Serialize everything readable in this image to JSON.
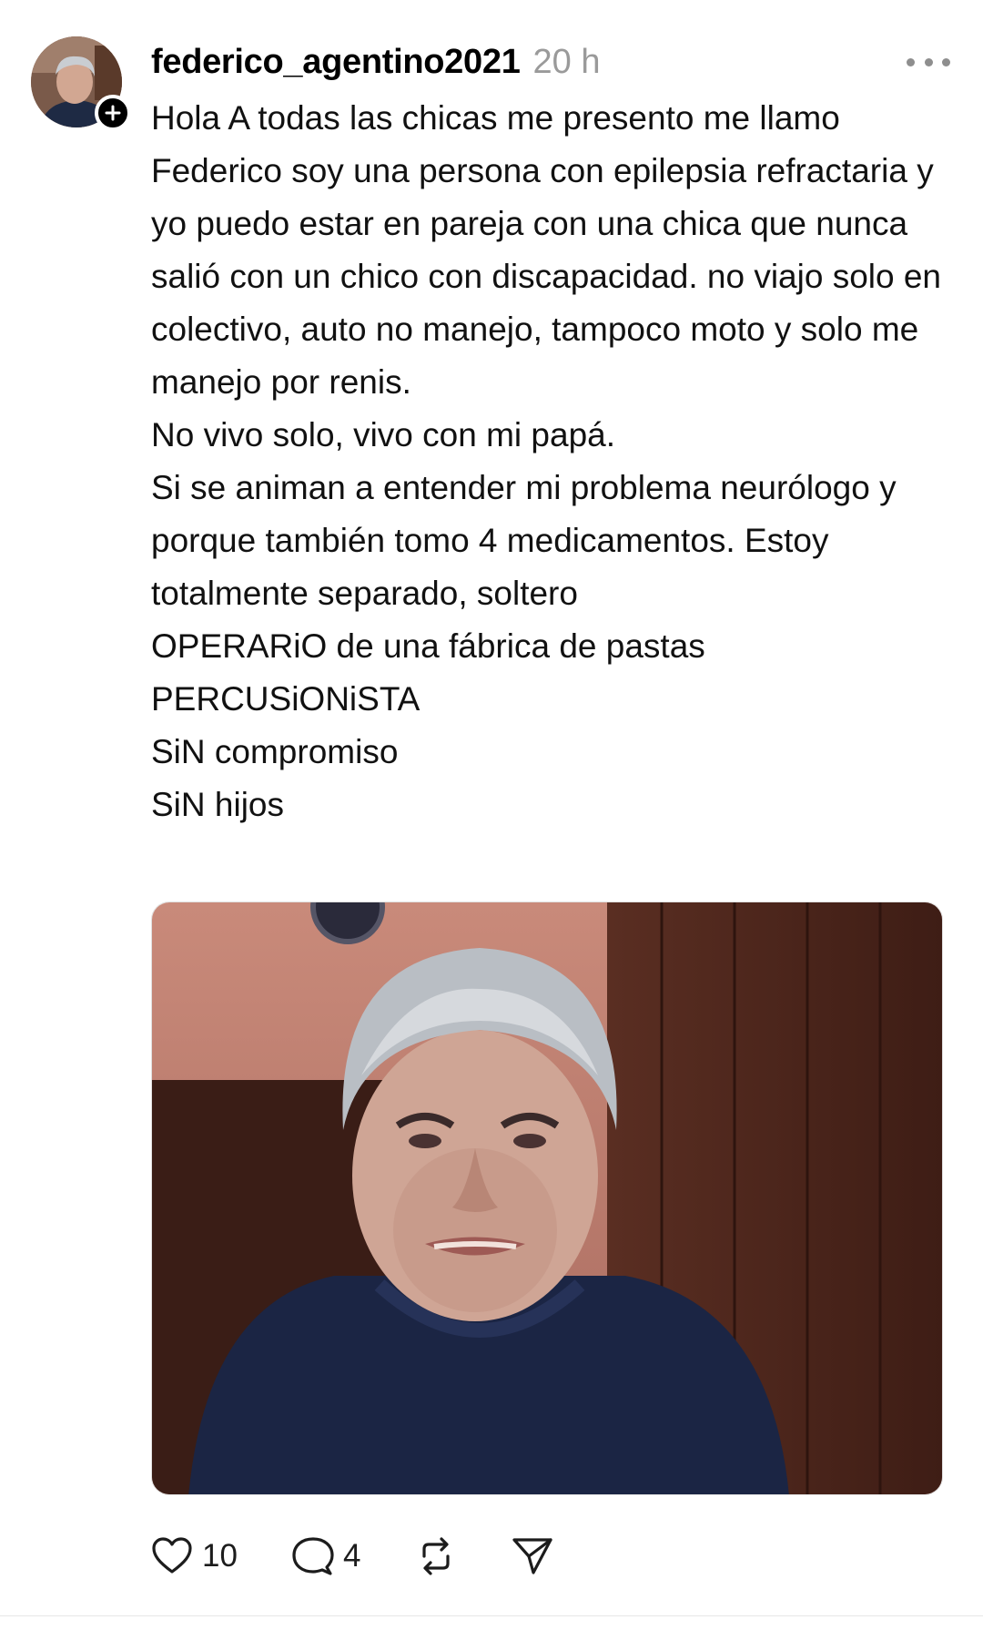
{
  "post": {
    "author": {
      "username": "federico_agentino2021",
      "avatar_icon": "profile-avatar",
      "follow_icon": "plus-icon"
    },
    "timestamp": "20 h",
    "more_icon": "more-horizontal-icon",
    "text_lines": [
      "Hola A todas las chicas me presento me llamo Federico soy una persona con epilepsia refractaria y yo puedo estar en pareja con una chica que nunca salió con un chico con discapacidad. no viajo solo en colectivo, auto no manejo, tampoco moto y solo me manejo por renis.",
      "No vivo solo, vivo con mi papá.",
      "Si se animan a entender mi problema neurólogo y porque también tomo 4 medicamentos. Estoy totalmente separado, soltero",
      "OPERARiO de una fábrica de pastas",
      "PERCUSiONiSTA",
      "SiN compromiso",
      "SiN hijos"
    ],
    "media": {
      "icon": "photo"
    },
    "actions": {
      "like": {
        "icon": "heart-icon",
        "count": "10"
      },
      "reply": {
        "icon": "comment-icon",
        "count": "4"
      },
      "repost": {
        "icon": "repost-icon"
      },
      "share": {
        "icon": "send-icon"
      }
    }
  },
  "colors": {
    "text": "#000000",
    "muted": "#9a9a9a",
    "background": "#ffffff"
  }
}
